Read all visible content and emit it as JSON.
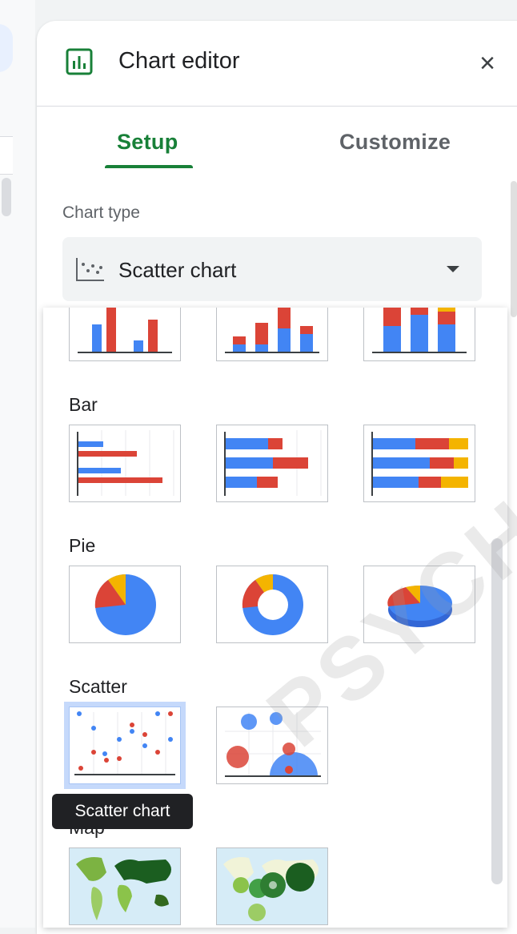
{
  "editor": {
    "title": "Chart editor",
    "close_icon": "close-icon"
  },
  "tabs": [
    {
      "label": "Setup",
      "active": true
    },
    {
      "label": "Customize",
      "active": false
    }
  ],
  "chart_type": {
    "label": "Chart type",
    "selected": "Scatter chart"
  },
  "groups": {
    "bar": "Bar",
    "pie": "Pie",
    "scatter": "Scatter",
    "map": "Map"
  },
  "tooltip": "Scatter chart",
  "watermark": "PSYCH",
  "colors": {
    "accent": "#188038",
    "blue": "#4285f4",
    "red": "#db4437",
    "yellow": "#f4b400",
    "green": "#0f9d58"
  }
}
